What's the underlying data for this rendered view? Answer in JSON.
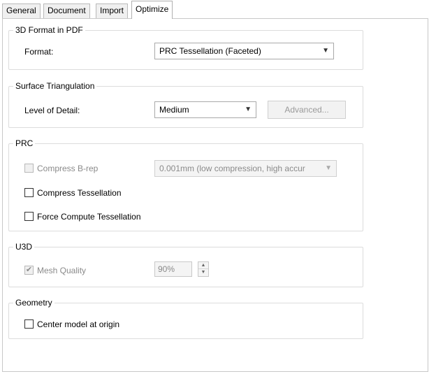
{
  "tabs": [
    {
      "label": "General"
    },
    {
      "label": "Document"
    },
    {
      "label": "Import"
    },
    {
      "label": "Optimize"
    }
  ],
  "format_group": {
    "title": "3D Format in PDF",
    "format_label": "Format:",
    "format_value": "PRC Tessellation (Faceted)"
  },
  "surface_group": {
    "title": "Surface Triangulation",
    "lod_label": "Level of Detail:",
    "lod_value": "Medium",
    "advanced_label": "Advanced..."
  },
  "prc_group": {
    "title": "PRC",
    "compress_brep_label": "Compress B-rep",
    "compress_brep_checked": false,
    "compress_brep_value": "0.001mm (low compression, high accur",
    "compress_tess_label": "Compress Tessellation",
    "compress_tess_checked": false,
    "force_compute_label": "Force Compute Tessellation",
    "force_compute_checked": false
  },
  "u3d_group": {
    "title": "U3D",
    "mesh_quality_label": "Mesh Quality",
    "mesh_quality_checked": true,
    "mesh_quality_value": "90%"
  },
  "geometry_group": {
    "title": "Geometry",
    "center_label": "Center model at origin",
    "center_checked": false
  },
  "icons": {
    "dropdown": "chevron-down-icon",
    "check": "checkmark-icon",
    "spin_up": "arrow-up-icon",
    "spin_down": "arrow-down-icon"
  }
}
